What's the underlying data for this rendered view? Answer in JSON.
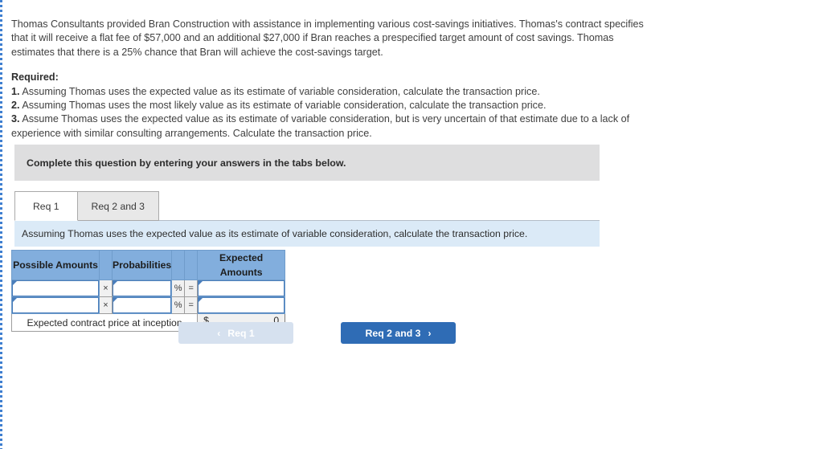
{
  "problem": {
    "paragraph": "Thomas Consultants provided Bran Construction with assistance in implementing various cost-savings initiatives. Thomas's contract specifies that it will receive a flat fee of $57,000 and an additional $27,000 if Bran reaches a prespecified target amount of cost savings. Thomas estimates that there is a 25% chance that Bran will achieve the cost-savings target.",
    "required_heading": "Required:",
    "requirements": [
      {
        "number": "1.",
        "text": "Assuming Thomas uses the expected value as its estimate of variable consideration, calculate the transaction price."
      },
      {
        "number": "2.",
        "text": "Assuming Thomas uses the most likely value as its estimate of variable consideration, calculate the transaction price."
      },
      {
        "number": "3.",
        "text": "Assume Thomas uses the expected value as its estimate of variable consideration, but is very uncertain of that estimate due to a lack of experience with similar consulting arrangements. Calculate the transaction price."
      }
    ]
  },
  "complete_bar": {
    "label": "Complete this question by entering your answers in the tabs below."
  },
  "tabs": [
    {
      "label": "Req 1",
      "active": true
    },
    {
      "label": "Req 2 and 3",
      "active": false
    }
  ],
  "question_strip": {
    "label": "Assuming Thomas uses the expected value as its estimate of variable consideration, calculate the transaction price."
  },
  "worksheet": {
    "headers": {
      "possible_amounts": "Possible Amounts",
      "probabilities": "Probabilities",
      "expected_amounts": "Expected Amounts"
    },
    "operators": {
      "multiply": "×",
      "percent": "%",
      "equals": "="
    },
    "rows": [
      {
        "possible_amount": "",
        "probability": "",
        "expected_amount": ""
      },
      {
        "possible_amount": "",
        "probability": "",
        "expected_amount": ""
      }
    ],
    "total": {
      "label": "Expected contract price at inception",
      "currency": "$",
      "value": "0"
    }
  },
  "navigation": {
    "prev": {
      "label": "Req 1",
      "chevron": "‹",
      "disabled": true
    },
    "next": {
      "label": "Req 2 and 3",
      "chevron": "›",
      "disabled": false
    }
  },
  "colors": {
    "header_blue": "#82aedd",
    "strip_blue": "#dbeaf7",
    "bar_gray": "#dededf",
    "button_blue": "#2f6cb5",
    "button_disabled": "#d6e1ef",
    "rail_blue": "#3f7fd0"
  }
}
